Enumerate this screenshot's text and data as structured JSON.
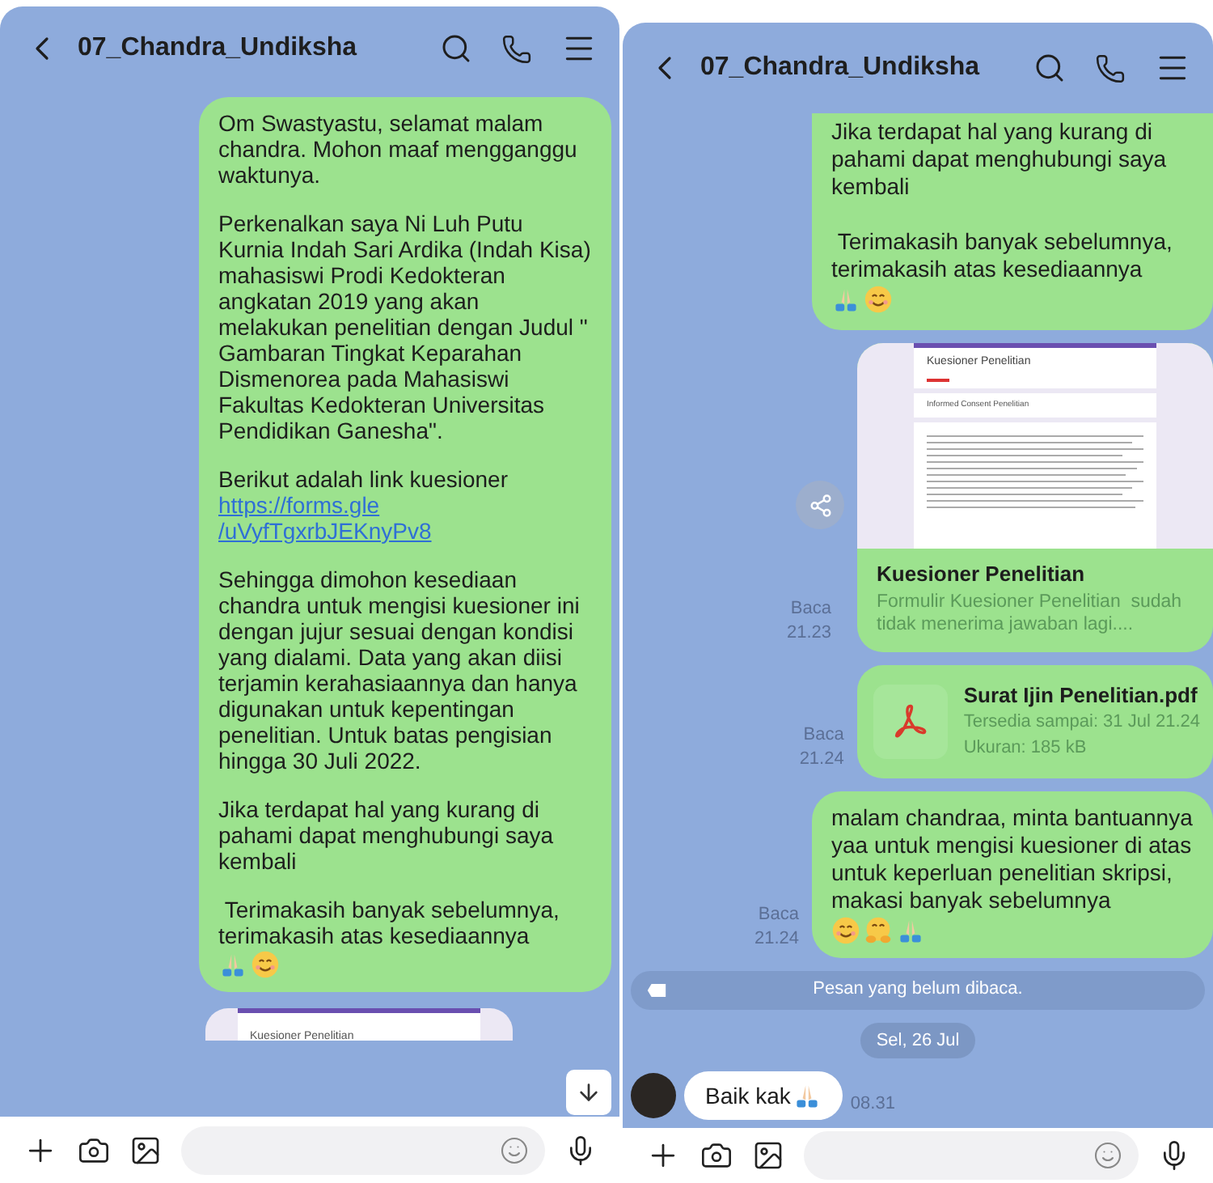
{
  "panels": [
    {
      "header": {
        "title": "07_Chandra_Undiksha"
      },
      "scroll_down_button": true,
      "messages": [
        {
          "kind": "text",
          "continued": false,
          "paragraphs": [
            {
              "text": "Om Swastyastu, selamat malam chandra. Mohon maaf mengganggu waktunya."
            },
            {
              "text": "Perkenalkan saya Ni Luh Putu Kurnia Indah Sari Ardika (Indah Kisa) mahasiswi Prodi Kedokteran angkatan 2019 yang akan melakukan penelitian dengan Judul \" Gambaran Tingkat Keparahan Dismenorea pada Mahasiswi Fakultas Kedokteran Universitas Pendidikan Ganesha\"."
            },
            {
              "text": "Berikut adalah link kuesioner",
              "link_lines": [
                "https://forms.gle",
                "/uVyfTgxrbJEKnyPv8"
              ]
            },
            {
              "text": "Sehingga dimohon kesediaan chandra untuk mengisi kuesioner ini dengan jujur sesuai dengan kondisi yang dialami. Data yang akan diisi terjamin kerahasiaannya dan hanya digunakan untuk kepentingan penelitian. Untuk batas pengisian hingga 30 Juli 2022."
            },
            {
              "text": "Jika terdapat hal yang kurang di pahami dapat menghubungi saya kembali"
            },
            {
              "text": " Terimakasih banyak sebelumnya, terimakasih atas kesediaannya",
              "kind": "thanks"
            }
          ]
        },
        {
          "kind": "preview-peek",
          "doc_title": "Kuesioner Penelitian"
        }
      ]
    },
    {
      "header": {
        "title": "07_Chandra_Undiksha"
      },
      "messages": [
        {
          "kind": "text",
          "continued": true,
          "paragraphs": [
            {
              "text": "Jika terdapat hal yang kurang di pahami dapat menghubungi saya kembali"
            },
            {
              "text": " Terimakasih banyak sebelumnya, terimakasih atas kesediaannya",
              "kind": "thanks"
            }
          ]
        },
        {
          "kind": "link",
          "doc_title": "Kuesioner Penelitian",
          "doc_subtitle": "Informed Consent Penelitian",
          "title": "Kuesioner Penelitian",
          "description": "Formulir Kuesioner Penelitian  sudah tidak menerima jawaban lagi....",
          "status": "Baca",
          "time": "21.23"
        },
        {
          "kind": "file",
          "name": "Surat Ijin Penelitian.pdf",
          "available": "Tersedia sampai: 31 Jul 21.24",
          "size": "Ukuran: 185 kB",
          "status": "Baca",
          "time": "21.24"
        },
        {
          "kind": "text",
          "continued": false,
          "status": "Baca",
          "time": "21.24",
          "paragraphs": [
            {
              "text": "malam chandraa, minta bantuannya yaa untuk mengisi kuesioner di atas untuk keperluan penelitian skripsi, makasi banyak sebelumnya",
              "kind": "request"
            }
          ]
        },
        {
          "kind": "notice",
          "text": "Pesan yang belum dibaca."
        },
        {
          "kind": "date",
          "text": "Sel, 26 Jul"
        },
        {
          "kind": "incoming",
          "text": "Baik kak",
          "time": "08.31"
        }
      ]
    }
  ]
}
